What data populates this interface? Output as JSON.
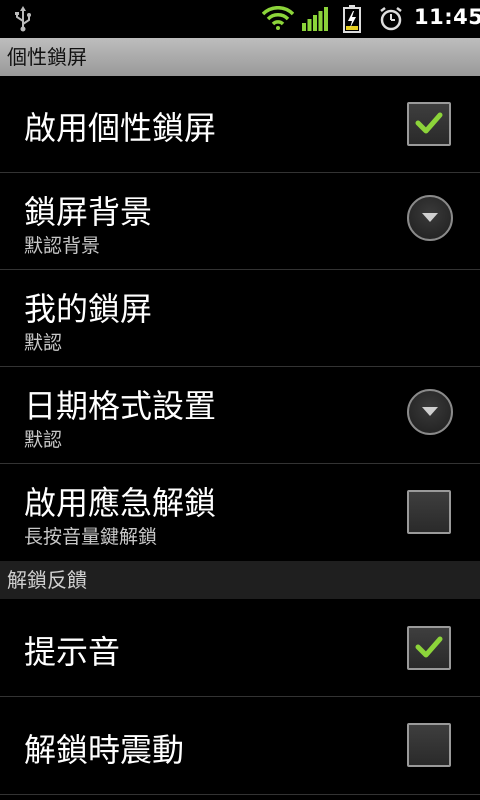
{
  "status_bar": {
    "time": "11:45",
    "icons": [
      "usb-icon",
      "wifi-icon",
      "signal-icon",
      "battery-charging-icon",
      "alarm-icon"
    ]
  },
  "screen": {
    "title": "個性鎖屏"
  },
  "prefs": [
    {
      "label": "啟用個性鎖屏",
      "summary": "",
      "widget": "checkbox",
      "checked": true
    },
    {
      "label": "鎖屏背景",
      "summary": "默認背景",
      "widget": "dropdown"
    },
    {
      "label": "我的鎖屏",
      "summary": "默認",
      "widget": "none"
    },
    {
      "label": "日期格式設置",
      "summary": "默認",
      "widget": "dropdown"
    },
    {
      "label": "啟用應急解鎖",
      "summary": "長按音量鍵解鎖",
      "widget": "checkbox",
      "checked": false
    }
  ],
  "section": {
    "title": "解鎖反饋"
  },
  "feedback_prefs": [
    {
      "label": "提示音",
      "widget": "checkbox",
      "checked": true
    },
    {
      "label": "解鎖時震動",
      "widget": "checkbox",
      "checked": false
    }
  ],
  "colors": {
    "accent_check": "#8cd43a",
    "wifi_signal": "#8cd43a",
    "background": "#000000",
    "title_bar": "#aaaaaa"
  }
}
